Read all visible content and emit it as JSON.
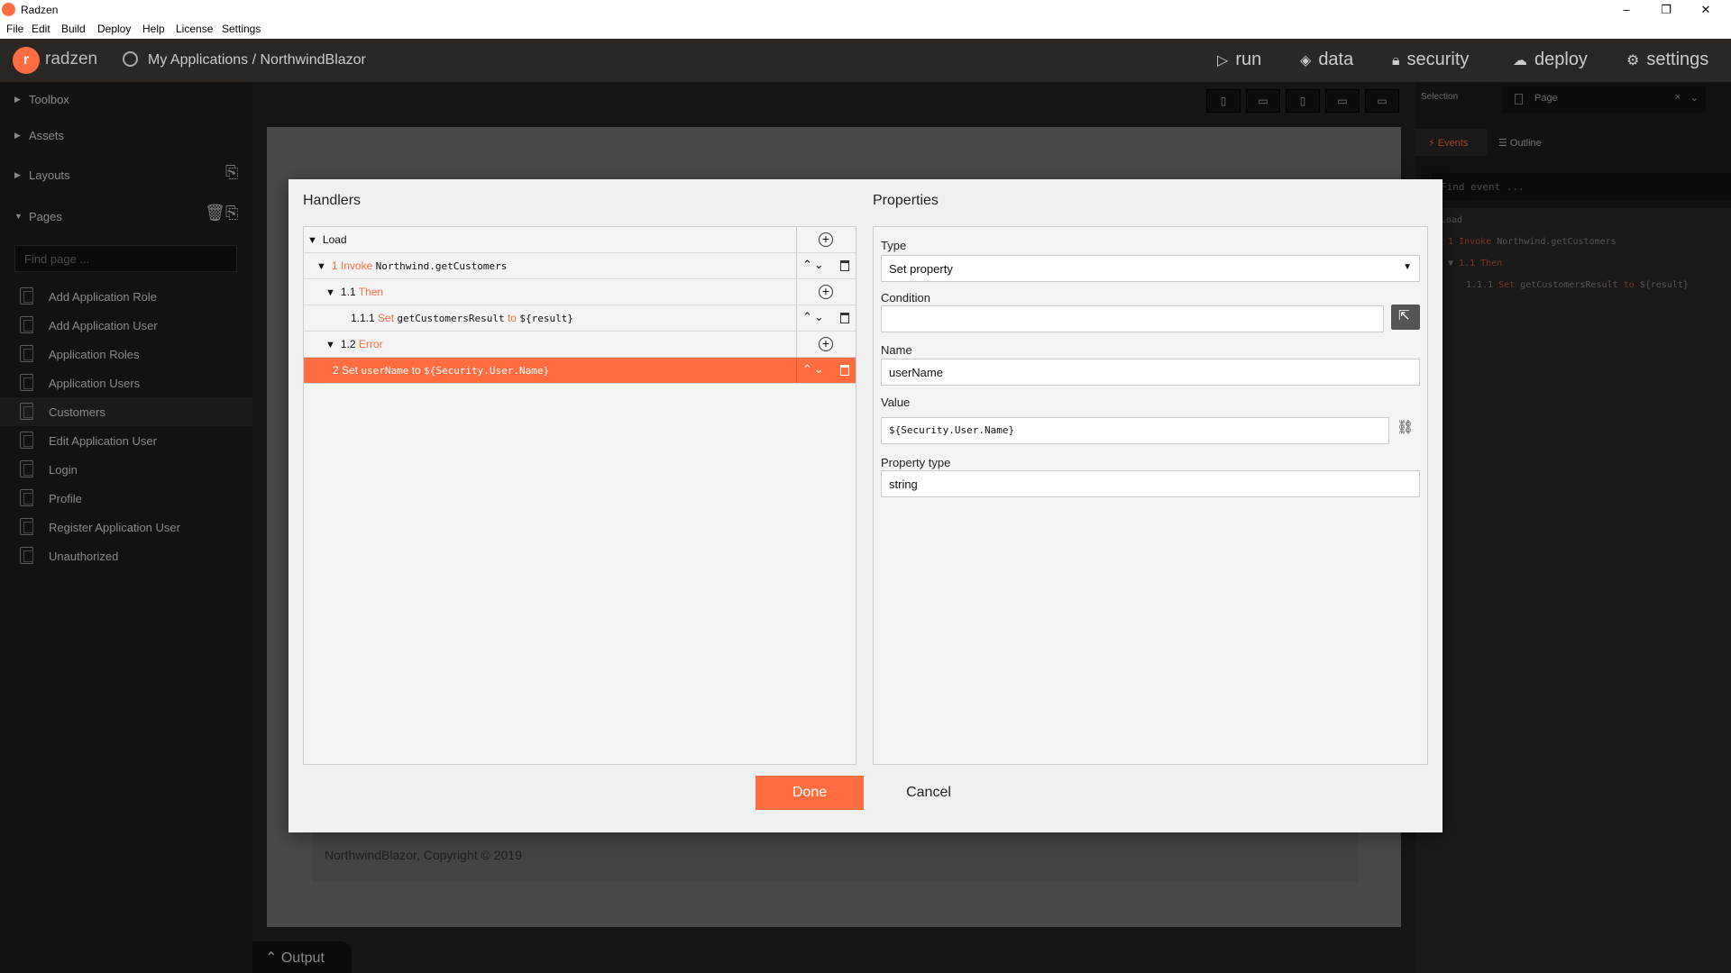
{
  "window": {
    "title": "Radzen",
    "controls": [
      "–",
      "❐",
      "✕"
    ]
  },
  "menu": [
    "File",
    "Edit",
    "Build",
    "Deploy",
    "Help",
    "License",
    "Settings"
  ],
  "header": {
    "brand": "radzen",
    "breadcrumb": "My Applications / NorthwindBlazor",
    "nav": [
      {
        "icon": "▷",
        "label": "run"
      },
      {
        "icon": "◈",
        "label": "data"
      },
      {
        "icon": "🔒︎",
        "label": "security"
      },
      {
        "icon": "☁",
        "label": "deploy"
      },
      {
        "icon": "⚙",
        "label": "settings"
      }
    ]
  },
  "sidebar": {
    "sections": [
      "Toolbox",
      "Assets",
      "Layouts",
      "Pages"
    ],
    "find_placeholder": "Find page ...",
    "pages": [
      "Add Application Role",
      "Add Application User",
      "Application Roles",
      "Application Users",
      "Customers",
      "Edit Application User",
      "Login",
      "Profile",
      "Register Application User",
      "Unauthorized"
    ],
    "active_page": "Customers"
  },
  "canvas": {
    "footer": "NorthwindBlazor, Copyright © 2019",
    "output_tab": "Output"
  },
  "right_panel": {
    "selection_label": "Selection",
    "selection_value": "Page",
    "tabs": {
      "events": "Events",
      "outline": "Outline"
    },
    "find_event_placeholder": "Find event ...",
    "tree": {
      "load": "Load",
      "r1_num": "1",
      "r1_kw": "Invoke",
      "r1_code": "Northwind.getCustomers",
      "r2_num": "1.1",
      "r2_kw": "Then",
      "r3_num": "1.1.1",
      "r3_kw": "Set",
      "r3_code": "getCustomersResult",
      "r3_to": "to",
      "r3_val": "${result}"
    }
  },
  "dialog": {
    "handlers_title": "Handlers",
    "properties_title": "Properties",
    "handlers": {
      "load": "Load",
      "r1_num": "1",
      "r1_kw": "Invoke",
      "r1_code": "Northwind.getCustomers",
      "r2_num": "1.1",
      "r2_kw": "Then",
      "r3_num": "1.1.1",
      "r3_kw": "Set",
      "r3_code": "getCustomersResult",
      "r3_to": "to",
      "r3_val": "${result}",
      "r4_num": "1.2",
      "r4_kw": "Error",
      "r5_num": "2",
      "r5_kw": "Set",
      "r5_code": "userName",
      "r5_to": "to",
      "r5_val": "${Security.User.Name}"
    },
    "properties": {
      "type_label": "Type",
      "type_value": "Set property",
      "condition_label": "Condition",
      "condition_value": "",
      "name_label": "Name",
      "name_value": "userName",
      "value_label": "Value",
      "value_value": "${Security.User.Name}",
      "ptype_label": "Property type",
      "ptype_value": "string"
    },
    "done": "Done",
    "cancel": "Cancel"
  }
}
